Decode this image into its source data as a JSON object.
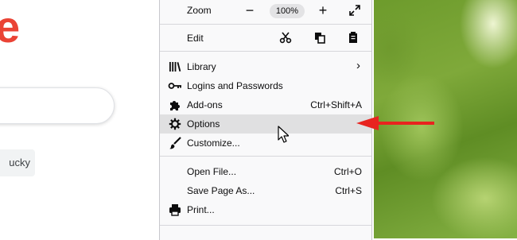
{
  "background": {
    "logo_fragment": "e",
    "lucky_fragment": "ucky"
  },
  "menu": {
    "zoom": {
      "label": "Zoom",
      "minus": "−",
      "value": "100%",
      "plus": "+",
      "fullscreen": "⤢"
    },
    "edit": {
      "label": "Edit",
      "cut_icon": "scissors-icon",
      "copy_icon": "copy-icon",
      "paste_icon": "paste-icon"
    },
    "items": [
      {
        "label": "Library",
        "shortcut": "›",
        "icon": "library-icon"
      },
      {
        "label": "Logins and Passwords",
        "shortcut": "",
        "icon": "key-icon"
      },
      {
        "label": "Add-ons",
        "shortcut": "Ctrl+Shift+A",
        "icon": "puzzle-icon"
      },
      {
        "label": "Options",
        "shortcut": "",
        "icon": "gear-icon",
        "highlighted": true
      },
      {
        "label": "Customize...",
        "shortcut": "",
        "icon": "paintbrush-icon"
      },
      {
        "label": "Open File...",
        "shortcut": "Ctrl+O",
        "icon": ""
      },
      {
        "label": "Save Page As...",
        "shortcut": "Ctrl+S",
        "icon": ""
      },
      {
        "label": "Print...",
        "shortcut": "",
        "icon": "printer-icon"
      }
    ]
  },
  "annotation": {
    "arrow_color": "#e8231f",
    "target": "Options"
  },
  "colors": {
    "menu_bg": "#f9f9fa",
    "highlight": "#e0e0e1",
    "logo_red": "#ea4335"
  }
}
